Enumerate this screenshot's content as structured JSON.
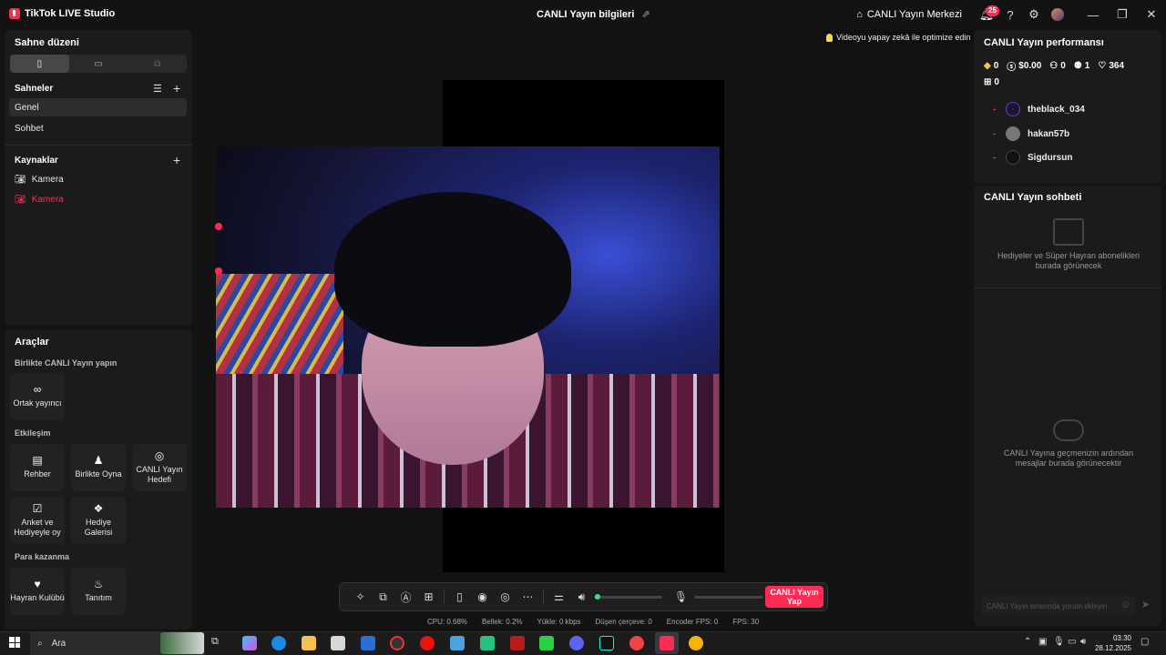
{
  "app": {
    "name": "TikTok LIVE Studio",
    "title": "CANLI Yayın bilgileri"
  },
  "header": {
    "live_center": "CANLI Yayın Merkezi",
    "notif_count": "25"
  },
  "left": {
    "layout_title": "Sahne düzeni",
    "scenes_title": "Sahneler",
    "scenes": [
      "Genel",
      "Sohbet"
    ],
    "sources_title": "Kaynaklar",
    "sources": [
      "Kamera",
      "Kamera"
    ],
    "tools_title": "Araçlar",
    "tools_sec1": "Birlikte CANLI Yayın yapın",
    "tool_cohost": "Ortak yayıncı",
    "tools_sec2": "Etkileşim",
    "tool_guide": "Rehber",
    "tool_play": "Birlikte Oyna",
    "tool_goal": "CANLI Yayın Hedefi",
    "tool_poll": "Anket ve Hediyeyle oy",
    "tool_gifts": "Hediye Galerisi",
    "tools_sec3": "Para kazanma",
    "tool_fanclub": "Hayran Kulübü",
    "tool_promo": "Tanıtım"
  },
  "center": {
    "optimize_tip": "Videoyu yapay zekâ ile optimize edin",
    "go_live": "CANLI Yayın Yap",
    "volume_level": 0.02,
    "stats": {
      "cpu": "CPU:  0.68%",
      "memory": "Bellek:  0.2%",
      "upload": "Yükle:  0 kbps",
      "dropped": "Düşen çerçeve:  0",
      "encoder": "Encoder FPS:  0",
      "fps": "FPS:  30"
    }
  },
  "right": {
    "perf_title": "CANLI Yayın performansı",
    "diamonds": "0",
    "earnings": "$0.00",
    "viewers": "0",
    "followers": "1",
    "likes": "364",
    "gifts": "0",
    "top_viewers": [
      {
        "rank": "-",
        "name": "theblack_034"
      },
      {
        "rank": "-",
        "name": "hakan57b"
      },
      {
        "rank": "-",
        "name": "Sigdursun"
      }
    ],
    "chat_title": "CANLI Yayın sohbeti",
    "gifts_empty": "Hediyeler ve Süper Hayran abonelikleri burada görünecek",
    "chat_empty": "CANLI Yayına geçmenizin ardından mesajlar burada görünecektir",
    "chat_placeholder": "CANLI Yayın sırasında yorum ekleyin"
  },
  "taskbar": {
    "search": "Ara",
    "time": "03:30",
    "date": "28.12.2025"
  },
  "colors": {
    "accent": "#fe2c55",
    "background": "#131313",
    "panel": "#1b1b1b"
  }
}
